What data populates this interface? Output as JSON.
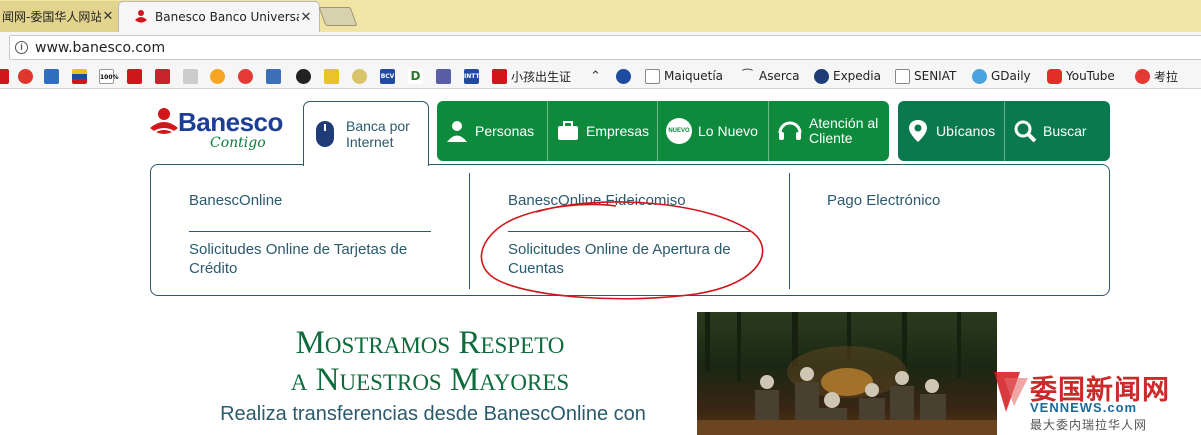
{
  "browser": {
    "tabs": [
      {
        "title": "闻网-委国华人网站",
        "active": false
      },
      {
        "title": "Banesco Banco Universal",
        "active": true
      }
    ],
    "close_glyph": "✕",
    "url": "www.banesco.com",
    "bookmarks": [
      {
        "label": "小孩出生证"
      },
      {
        "label": "Maiquetía"
      },
      {
        "label": "Aserca"
      },
      {
        "label": "Expedia"
      },
      {
        "label": "SENIAT"
      },
      {
        "label": "GDaily"
      },
      {
        "label": "YouTube"
      },
      {
        "label": "考拉"
      }
    ],
    "bookmark_icon_labels": [
      "100%",
      "BCV",
      "D",
      "INTT"
    ]
  },
  "site": {
    "logo": {
      "name": "Banesco",
      "tagline": "Contigo"
    },
    "nav": {
      "banca": "Banca por Internet",
      "personas": "Personas",
      "empresas": "Empresas",
      "nuevo": "Lo Nuevo",
      "nuevo_badge": "NUEVO",
      "atencion": "Atención al Cliente",
      "ubicanos": "Ubícanos",
      "buscar": "Buscar"
    },
    "dropdown": {
      "col1": [
        "BanescOnline",
        "Solicitudes Online de Tarjetas de Crédito"
      ],
      "col2": [
        "BanescOnline Fideicomiso",
        "Solicitudes Online de Apertura de Cuentas"
      ],
      "col3": [
        "Pago Electrónico"
      ]
    },
    "hero": {
      "title_line1": "Mostramos Respeto",
      "title_line2": "a Nuestros Mayores",
      "subtitle": "Realiza transferencias desde BanescOnline con"
    }
  },
  "watermark": {
    "title": "委国新闻网",
    "domain": "VENNEWS.com",
    "slogan": "最大委内瑞拉华人网"
  },
  "colors": {
    "brand_green": "#0e8a3c",
    "brand_dark_green": "#0a7a4e",
    "brand_teal": "#2a5a6e",
    "annotation_red": "#d0161b"
  }
}
